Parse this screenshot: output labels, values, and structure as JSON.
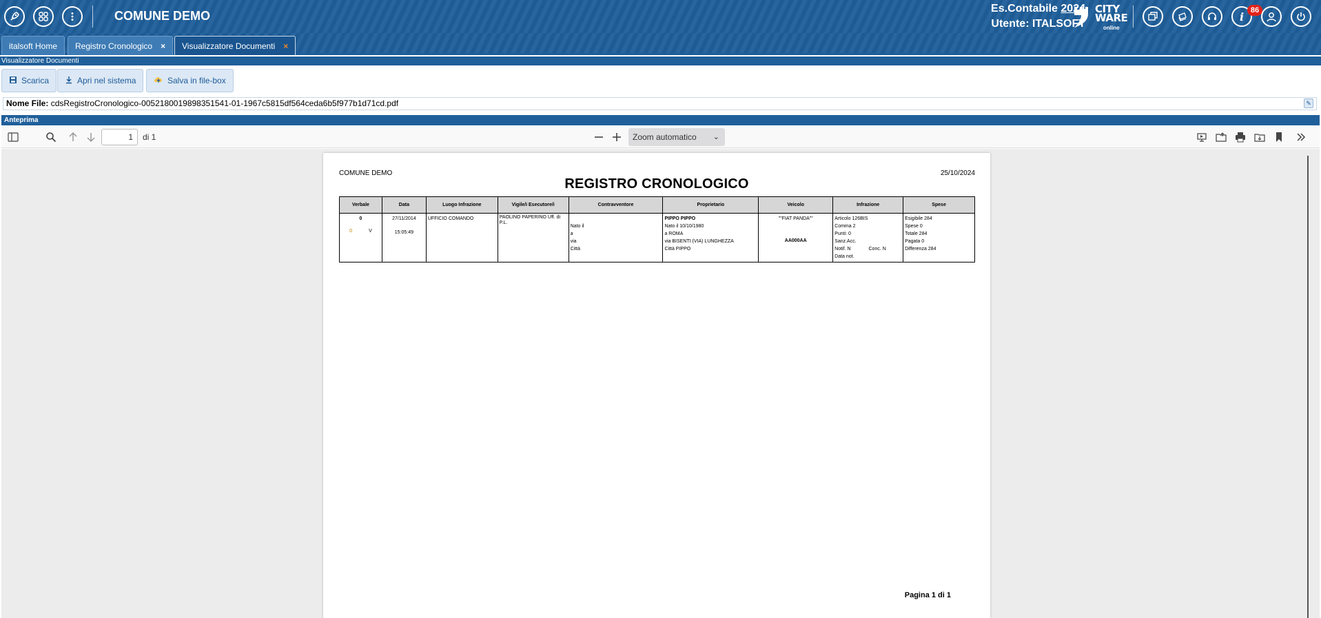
{
  "header": {
    "app_title": "COMUNE DEMO",
    "es_contabile_label": "Es.Contabile",
    "es_contabile_year": "2024",
    "utente": "Utente: ITALSOFT",
    "logo_line1": "CITY",
    "logo_line2": "WARE",
    "logo_sub": "online",
    "notification_count": "86",
    "left_icons": [
      "rocket-icon",
      "apps-grid-icon",
      "more-vertical-icon"
    ],
    "right_icons": [
      "windows-icon",
      "layers-icon",
      "headset-icon",
      "info-icon",
      "user-icon",
      "power-icon"
    ]
  },
  "tabs": [
    {
      "label": "italsoft Home",
      "closable": false
    },
    {
      "label": "Registro Cronologico",
      "closable": true
    },
    {
      "label": "Visualizzatore Documenti",
      "closable": true,
      "active": true
    }
  ],
  "tab_close": "×",
  "subtitle": "Visualizzatore Documenti",
  "toolbar": {
    "scarica": "Scarica",
    "apri": "Apri nel sistema",
    "salva": "Salva in file-box"
  },
  "file": {
    "label": "Nome File:",
    "name": "cdsRegistroCronologico-0052180019898351541-01-1967c5815df564ceda6b5f977b1d71cd.pdf"
  },
  "anteprima": "Anteprima",
  "viewer": {
    "page_number": "1",
    "page_of": "di 1",
    "zoom": "Zoom automatico"
  },
  "document": {
    "ente": "COMUNE DEMO",
    "date": "25/10/2024",
    "title": "REGISTRO CRONOLOGICO",
    "columns": [
      "Verbale",
      "Data",
      "Luogo Infrazione",
      "Vigile/i Esecutore/i",
      "Contravventore",
      "Proprietario",
      "Veicolo",
      "Infrazione",
      "Spese"
    ],
    "row": {
      "verbale_num": "0",
      "verbale_a": "0",
      "verbale_b": "V",
      "data": "27/11/2014",
      "ora": "15:05:49",
      "luogo": "UFFICIO COMANDO",
      "vigili": "PAOLINO PAPERINO  Uff. di P.L.",
      "contravventore": [
        "Nato il",
        "a",
        "via",
        "Città"
      ],
      "proprietario_nome": "PIPPO PIPPO",
      "proprietario": [
        "Nato il 10/10/1980",
        "a ROMA",
        "via BISENTI (VIA) LUNGHEZZA",
        "Città PIPPO"
      ],
      "veicolo_modello": "\"\"FIAT PANDA\"\"",
      "veicolo_targa": "AA000AA",
      "infrazione": [
        "Articolo 126BIS",
        "Comma 2",
        "Punti: 0",
        "Sanz.Acc.",
        "Notif. N",
        "Data not."
      ],
      "infrazione_conc": "Conc. N",
      "spese": [
        "Esigibile 284",
        "Spese 0",
        "Totale 284",
        "Pagata 0",
        "Differenza 284"
      ]
    },
    "footer": "Pagina 1 di 1"
  }
}
